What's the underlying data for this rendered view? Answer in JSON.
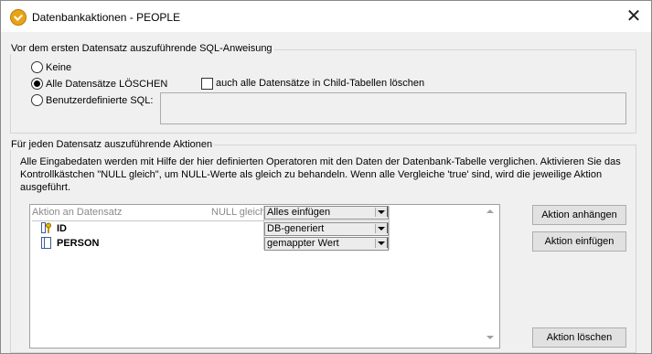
{
  "window": {
    "title": "Datenbankaktionen - PEOPLE",
    "close_label": "✕"
  },
  "before_first": {
    "legend": "Vor dem ersten Datensatz auszuführende SQL-Anweisung",
    "options": [
      {
        "label": "Keine",
        "selected": false
      },
      {
        "label": "Alle Datensätze LÖSCHEN",
        "selected": true
      },
      {
        "label": "Benutzerdefinierte SQL:",
        "selected": false
      }
    ],
    "child_delete_label": "auch alle Datensätze in Child-Tabellen löschen",
    "child_delete_checked": false,
    "custom_sql_value": ""
  },
  "per_record": {
    "legend": "Für jeden Datensatz auszuführende Aktionen",
    "description_lines": [
      "Alle Eingabedaten werden mit Hilfe der hier definierten Operatoren mit den Daten der Datenbank-Tabelle verglichen. Aktivieren Sie das",
      "Kontrollkästchen \"NULL gleich\", um NULL-Werte als gleich zu behandeln. Wenn alle Vergleiche 'true' sind, wird die jeweilige Aktion",
      "ausgeführt."
    ],
    "grid": {
      "header_action": "Aktion an Datensatz",
      "header_null": "NULL gleich",
      "header_dropdown": "Alles einfügen",
      "rows": [
        {
          "name": "ID",
          "icon": "key-column-icon",
          "value": "DB-generiert"
        },
        {
          "name": "PERSON",
          "icon": "column-icon",
          "value": "gemappter Wert"
        }
      ]
    },
    "buttons": {
      "append": "Aktion anhängen",
      "insert": "Aktion einfügen",
      "delete": "Aktion löschen"
    }
  }
}
